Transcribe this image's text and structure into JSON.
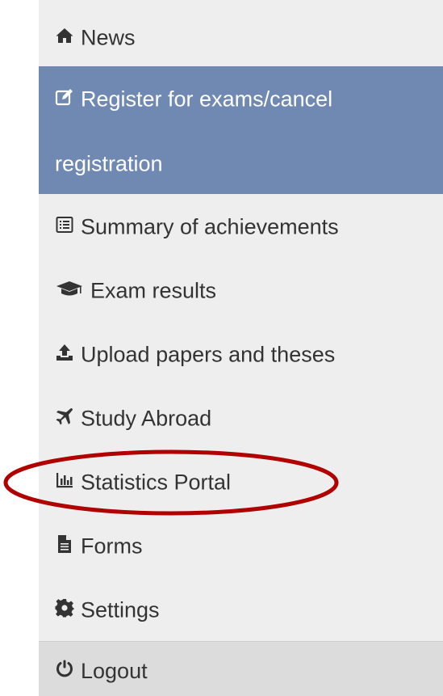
{
  "menu": {
    "items": [
      {
        "label": "News",
        "icon": "home-icon"
      },
      {
        "label": "Register for exams/cancel registration",
        "icon": "edit-icon"
      },
      {
        "label": "Summary of achievements",
        "icon": "list-alt-icon"
      },
      {
        "label": "Exam results",
        "icon": "graduation-cap-icon"
      },
      {
        "label": "Upload papers and theses",
        "icon": "upload-icon"
      },
      {
        "label": "Study Abroad",
        "icon": "plane-icon"
      },
      {
        "label": "Statistics Portal",
        "icon": "bar-chart-icon"
      },
      {
        "label": "Forms",
        "icon": "file-icon"
      },
      {
        "label": "Settings",
        "icon": "cog-icon"
      },
      {
        "label": "Logout",
        "icon": "power-icon"
      }
    ],
    "active_index": 1,
    "highlighted_index": 6
  },
  "colors": {
    "sidebar_bg": "#eeeeee",
    "active_bg": "#7089b3",
    "text": "#333333",
    "highlight_ring": "#b00000",
    "logout_bg": "#dcdcdc"
  }
}
